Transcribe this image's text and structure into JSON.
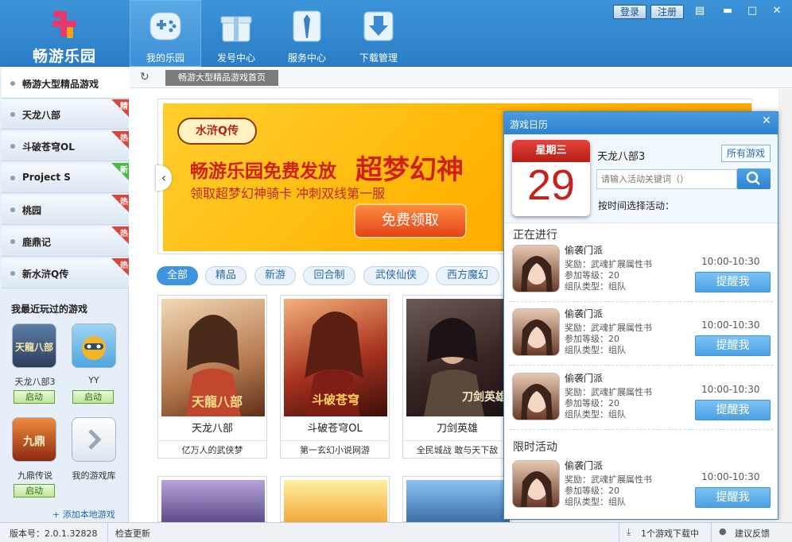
{
  "app": {
    "name": "畅游乐园"
  },
  "header": {
    "nav": [
      {
        "label": "我的乐园",
        "icon": "gamepad-icon",
        "active": true
      },
      {
        "label": "发号中心",
        "icon": "gift-icon",
        "active": false
      },
      {
        "label": "服务中心",
        "icon": "service-icon",
        "active": false
      },
      {
        "label": "下载管理",
        "icon": "download-icon",
        "active": false
      }
    ],
    "login": "登录",
    "register": "注册"
  },
  "sidebar": {
    "items": [
      {
        "label": "畅游大型精品游戏",
        "badge": ""
      },
      {
        "label": "天龙八部",
        "badge": "精"
      },
      {
        "label": "斗破苍穹OL",
        "badge": "热"
      },
      {
        "label": "Project S",
        "badge": "新"
      },
      {
        "label": "桃园",
        "badge": "热"
      },
      {
        "label": "鹿鼎记",
        "badge": "热"
      },
      {
        "label": "新水浒Q传",
        "badge": "热"
      }
    ],
    "recent_title": "我最近玩过的游戏",
    "recent": [
      {
        "name": "天龙八部3",
        "button": "启动"
      },
      {
        "name": "YY",
        "button": "启动"
      },
      {
        "name": "九鼎传说",
        "button": "启动"
      },
      {
        "name": "我的游戏库",
        "button": ""
      }
    ],
    "add_local": "+ 添加本地游戏"
  },
  "toolbar": {
    "tab": "畅游大型精品游戏首页"
  },
  "banner": {
    "game_logo": "水浒Q传",
    "headline_a": "畅游乐园免费发放",
    "headline_b": "超梦幻神",
    "subline": "领取超梦幻神骑卡 冲刺双线第一服",
    "cta": "免费领取"
  },
  "categories": [
    "全部",
    "精品",
    "新游",
    "回合制",
    "武侠仙侠",
    "西方魔幻"
  ],
  "games": [
    {
      "name": "天龙八部",
      "desc": "亿万人的武侠梦",
      "art": "天龍八部"
    },
    {
      "name": "斗破苍穹OL",
      "desc": "第一玄幻小说网游",
      "art": "斗破苍穹"
    },
    {
      "name": "刀剑英雄",
      "desc": "全民城战  敢与天下敌",
      "art": "刀剑英雄"
    }
  ],
  "calendar": {
    "title": "游戏日历",
    "weekday": "星期三",
    "day": "29",
    "game": "天龙八部3",
    "all_games": "所有游戏",
    "search_placeholder": "请输入活动关键词（）",
    "by_time": "按时间选择活动：",
    "ongoing_title": "正在进行",
    "limited_title": "限时活动",
    "events": [
      {
        "name": "偷袭门派",
        "reward": "奖励：武魂扩展属性书",
        "level": "参加等级：20",
        "team": "组队类型：组队",
        "time": "10:00-10:30",
        "button": "提醒我"
      },
      {
        "name": "偷袭门派",
        "reward": "奖励：武魂扩展属性书",
        "level": "参加等级：20",
        "team": "组队类型：组队",
        "time": "10:00-10:30",
        "button": "提醒我"
      },
      {
        "name": "偷袭门派",
        "reward": "奖励：武魂扩展属性书",
        "level": "参加等级：20",
        "team": "组队类型：组队",
        "time": "10:00-10:30",
        "button": "提醒我"
      },
      {
        "name": "偷袭门派",
        "reward": "奖励：武魂扩展属性书",
        "level": "参加等级：20",
        "team": "组队类型：组队",
        "time": "10:00-10:30",
        "button": "提醒我"
      }
    ]
  },
  "footer": {
    "version": "版本号：2.0.1.32828",
    "check_update": "检查更新",
    "downloads": "1个游戏下载中",
    "feedback": "建议反馈"
  },
  "colors": {
    "primary": "#2f86d2",
    "banner": "#ffb800",
    "badge_hot": "#e0453a",
    "badge_new": "#4cb848"
  }
}
